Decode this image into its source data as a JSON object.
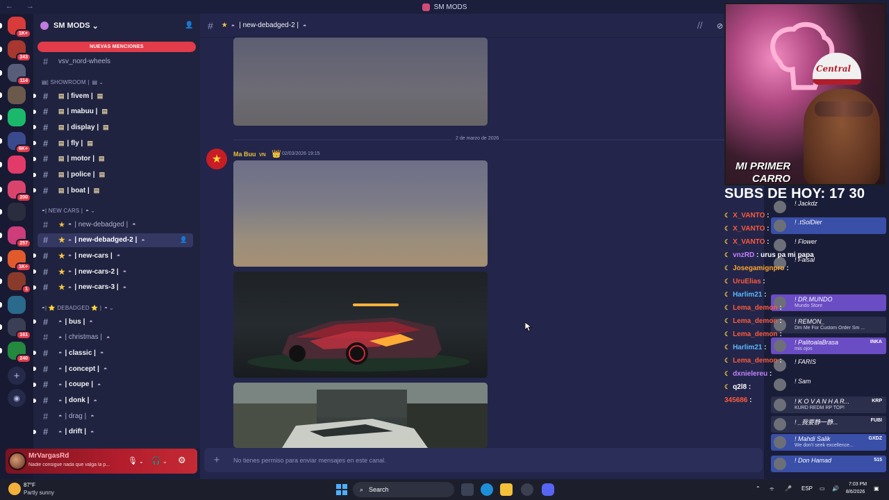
{
  "window": {
    "title": "SM MODS",
    "nav": "← →"
  },
  "rail": {
    "servers": [
      {
        "badge": "1K+",
        "color": "#d93a3a"
      },
      {
        "badge": "243",
        "color": "#a8372f"
      },
      {
        "badge": "114",
        "color": "#585e7a"
      },
      {
        "badge": "",
        "color": "#6b5a4c"
      },
      {
        "badge": "",
        "color": "#1bb86c"
      },
      {
        "badge": "6K+",
        "color": "#3b4a8c"
      },
      {
        "badge": "",
        "color": "#e23b6a"
      },
      {
        "badge": "200",
        "color": "#d9446d"
      },
      {
        "badge": "",
        "color": "#2a2d3d"
      },
      {
        "badge": "257",
        "color": "#cc3d7a"
      },
      {
        "badge": "1K+",
        "color": "#e05a2c"
      },
      {
        "badge": "1",
        "color": "#8a3a2a"
      },
      {
        "badge": "",
        "color": "#2a6a8c"
      },
      {
        "badge": "161",
        "color": "#3a3f55"
      },
      {
        "badge": "240",
        "color": "#24883e"
      }
    ],
    "add_icon": "+",
    "discover_icon": "◉"
  },
  "sidebar": {
    "server_name": "SM MODS",
    "server_chevron": "⌄",
    "mentions_banner": "NUEVAS MENCIONES",
    "top_channel": "vsv_nord-wheels",
    "categories": {
      "showroom": "| SHOWROOM |",
      "new_cars": "| NEW CARS |",
      "debadged": "| ⭐ DEBADGED ⭐ |"
    },
    "showroom_channels": [
      "| fivem |",
      "| mabuu |",
      "| display |",
      "| fly |",
      "| motor |",
      "| police |",
      "| boat |"
    ],
    "newcars_channels": [
      "| new-debadged |",
      "| new-debadged-2 |",
      "| new-cars |",
      "| new-cars-2 |",
      "| new-cars-3 |"
    ],
    "debadged_channels": [
      "| bus |",
      "| christmas |",
      "| classic |",
      "| concept |",
      "| coupe |",
      "| donk |",
      "| drag |",
      "| drift |"
    ]
  },
  "user": {
    "name": "MrVargasRd",
    "status": "Nadie consigue nada que valga la p..."
  },
  "channel": {
    "name": "| new-debadged-2 |",
    "date_separator": "2 de marzo de 2026",
    "author": "Ma Buu",
    "author_tag": "VN",
    "timestamp": "02/03/2026 19:15",
    "composer_placeholder": "No tienes permiso para enviar mensajes en este canal."
  },
  "stream": {
    "cap_text": "Central",
    "title_line1": "MI PRIMER",
    "title_line2": "CARRO",
    "subs": "SUBS DE HOY: 17 30"
  },
  "chat": [
    {
      "name": "X_VANTO",
      "color": "#ff5a3c",
      "text": ""
    },
    {
      "name": "X_VANTO",
      "color": "#ff5a3c",
      "text": ""
    },
    {
      "name": "X_VANTO",
      "color": "#ff5a3c",
      "text": ""
    },
    {
      "name": "vnzRD",
      "color": "#c580ff",
      "text": "urus pa mi papa"
    },
    {
      "name": "Josegamignpro",
      "color": "#ffa52c",
      "text": ""
    },
    {
      "name": "UruElias",
      "color": "#ff5a3c",
      "text": ""
    },
    {
      "name": "Harlim21",
      "color": "#5ab8ff",
      "text": ""
    },
    {
      "name": "Lema_demon",
      "color": "#ff5a3c",
      "text": ""
    },
    {
      "name": "Lema_demon",
      "color": "#ff5a3c",
      "text": ""
    },
    {
      "name": "Lema_demon",
      "color": "#ff5a3c",
      "text": ""
    },
    {
      "name": "Harlim21",
      "color": "#5ab8ff",
      "text": ""
    },
    {
      "name": "Lema_demon",
      "color": "#ff5a3c",
      "text": ""
    },
    {
      "name": "dxnielereu",
      "color": "#c580ff",
      "text": ""
    },
    {
      "name": "q2l8",
      "color": "#ffffff",
      "text": ""
    },
    {
      "name": "345686",
      "color": "#ff5a3c",
      "text": ""
    }
  ],
  "alerts": [
    {
      "name": "! Jackdz",
      "sub": "",
      "tag": "",
      "bg": "rgba(40,40,60,0)"
    },
    {
      "name": "! .tSolDier",
      "sub": "",
      "tag": "",
      "bg": "#3a4fa8"
    },
    {
      "name": "! Flower",
      "sub": "",
      "tag": "",
      "bg": "rgba(40,40,60,0)"
    },
    {
      "name": "! Faisal",
      "sub": "",
      "tag": "",
      "bg": "rgba(40,40,60,0)"
    },
    {
      "name": "! DR.MUNDO",
      "sub": "Mundo Store",
      "tag": "",
      "bg": "#6a4cc4"
    },
    {
      "name": "! REMON_",
      "sub": "Dm Me For Custom Order Sm ...",
      "tag": "",
      "bg": "#2c2f4c"
    },
    {
      "name": "! PalitoalaBrasa",
      "sub": "mis ojos",
      "tag": "INKA",
      "bg": "#6a4cc4"
    },
    {
      "name": "! FARIS",
      "sub": "",
      "tag": "",
      "bg": "rgba(40,40,60,0)"
    },
    {
      "name": "! Sam",
      "sub": "",
      "tag": "",
      "bg": "rgba(40,40,60,0)"
    },
    {
      "name": "! K O V A N H A R...",
      "sub": "KURD REDM RP TOP!",
      "tag": "KRP",
      "bg": "#2c2f4c"
    },
    {
      "name": "! _我要静一静...",
      "sub": "",
      "tag": "FUBI",
      "bg": "#2c2f4c"
    },
    {
      "name": "! Mahdi Salik",
      "sub": "We don't seek excellence...",
      "tag": "GXDZ",
      "bg": "#3a4fa8"
    },
    {
      "name": "! Don Hamad",
      "sub": "",
      "tag": "515",
      "bg": "#3a4fa8"
    }
  ],
  "taskbar": {
    "temp": "87°F",
    "weather": "Partly sunny",
    "search": "Search",
    "lang": "ESP",
    "time": "7:03 PM",
    "date": "8/6/2026"
  }
}
